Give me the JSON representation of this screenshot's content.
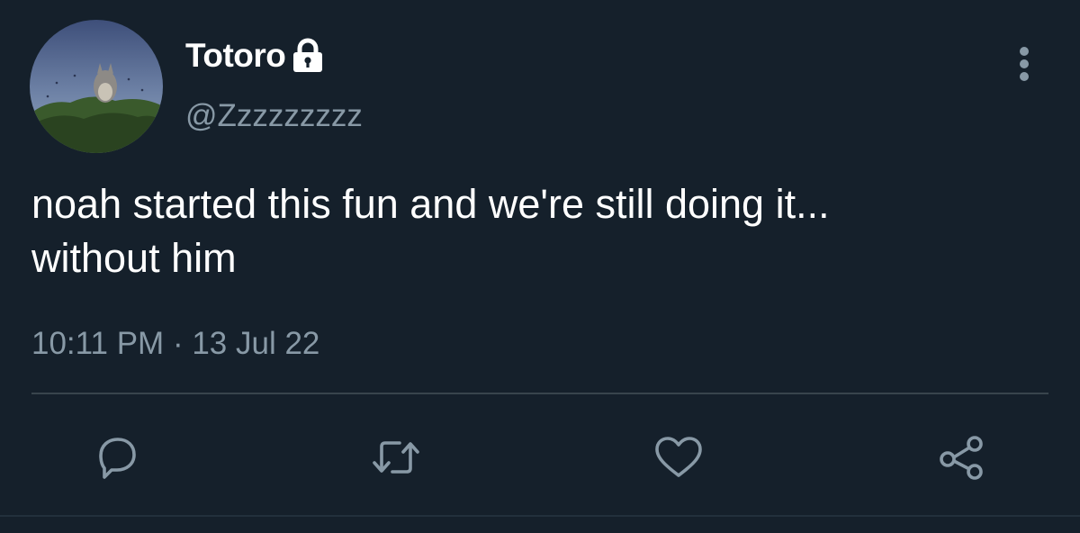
{
  "user": {
    "display_name": "Totoro",
    "handle": "@Zzzzzzzzz",
    "protected": true,
    "avatar": "totoro-avatar"
  },
  "tweet": {
    "text_lines": [
      "noah started this fun and we're still doing it...",
      "without him"
    ],
    "time": "10:11 PM",
    "separator": "·",
    "date": "13 Jul 22"
  },
  "icons": {
    "lock": "lock-icon",
    "more": "more-vertical-icon",
    "reply": "reply-icon",
    "retweet": "retweet-icon",
    "like": "heart-icon",
    "share": "share-icon"
  },
  "colors": {
    "background": "#15202b",
    "text": "#ffffff",
    "secondary_text": "#8899a6",
    "icon": "#8899a6",
    "divider": "#38444d"
  }
}
